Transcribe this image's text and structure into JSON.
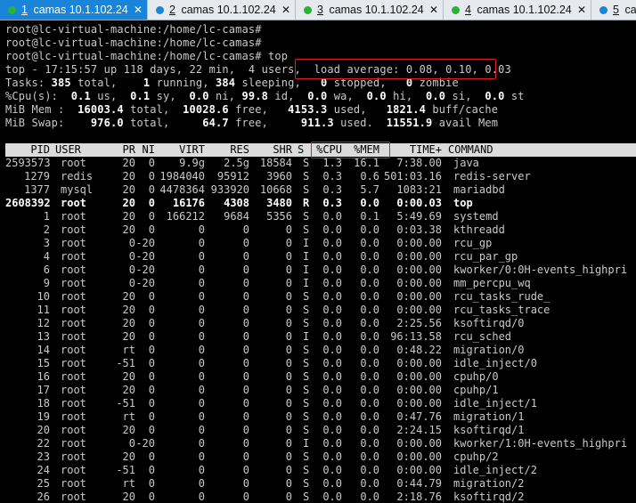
{
  "tabs": [
    {
      "num": "1",
      "label": "camas 10.1.102.24",
      "active": true
    },
    {
      "num": "2",
      "label": "camas 10.1.102.24",
      "active": false
    },
    {
      "num": "3",
      "label": "camas 10.1.102.24",
      "active": false
    },
    {
      "num": "4",
      "label": "camas 10.1.102.24",
      "active": false
    },
    {
      "num": "5",
      "label": "ca",
      "active": false
    }
  ],
  "prompts": [
    "root@lc-virtual-machine:/home/lc-camas#",
    "root@lc-virtual-machine:/home/lc-camas#",
    "root@lc-virtual-machine:/home/lc-camas# top"
  ],
  "summary": {
    "top_line_a": "top - 17:15:57 up 118 days, 22 min,  4 users,  ",
    "load_average": "load average: 0.08, 0.10, 0.03",
    "tasks_label": "Tasks: ",
    "tasks_total": "385",
    "tasks_t1": " total,    ",
    "tasks_running": "1",
    "tasks_t2": " running, ",
    "tasks_sleeping": "384",
    "tasks_t3": " sleeping,   ",
    "tasks_stopped": "0",
    "tasks_t4": " stopped,   ",
    "tasks_zombie": "0",
    "tasks_t5": " zombie",
    "cpu_label": "%Cpu(s):  ",
    "cpu_us": "0.1",
    "cpu_t1": " us,  ",
    "cpu_sy": "0.1",
    "cpu_t2": " sy,  ",
    "cpu_ni": "0.0",
    "cpu_t3": " ni, ",
    "cpu_id": "99.8",
    "cpu_t4": " id,  ",
    "cpu_wa": "0.0",
    "cpu_t5": " wa,  ",
    "cpu_hi": "0.0",
    "cpu_t6": " hi,  ",
    "cpu_si": "0.0",
    "cpu_t7": " si,  ",
    "cpu_st": "0.0",
    "cpu_t8": " st",
    "mem_label": "MiB Mem :  ",
    "mem_total": "16003.4",
    "mem_t1": " total,  ",
    "mem_free": "10028.6",
    "mem_t2": " free,   ",
    "mem_used": "4153.3",
    "mem_t3": " used,   ",
    "mem_buff": "1821.4",
    "mem_t4": " buff/cache",
    "swap_label": "MiB Swap:    ",
    "swap_total": "976.0",
    "swap_t1": " total,     ",
    "swap_free": "64.7",
    "swap_t2": " free,     ",
    "swap_used": "911.3",
    "swap_t3": " used.  ",
    "swap_avail": "11551.9",
    "swap_t4": " avail Mem"
  },
  "columns": [
    "PID",
    "USER",
    "PR",
    "NI",
    "VIRT",
    "RES",
    "SHR",
    "S",
    "%CPU",
    "%MEM",
    "TIME+",
    "COMMAND"
  ],
  "processes": [
    {
      "pid": "2593573",
      "user": "root",
      "pr": "20",
      "ni": "0",
      "virt": "9.9g",
      "res": "2.5g",
      "shr": "18584",
      "s": "S",
      "cpu": "1.3",
      "mem": "16.1",
      "time": "7:38.00",
      "cmd": "java",
      "bold": false
    },
    {
      "pid": "1279",
      "user": "redis",
      "pr": "20",
      "ni": "0",
      "virt": "1984040",
      "res": "95912",
      "shr": "3960",
      "s": "S",
      "cpu": "0.3",
      "mem": "0.6",
      "time": "501:03.16",
      "cmd": "redis-server",
      "bold": false
    },
    {
      "pid": "1377",
      "user": "mysql",
      "pr": "20",
      "ni": "0",
      "virt": "4478364",
      "res": "933920",
      "shr": "10668",
      "s": "S",
      "cpu": "0.3",
      "mem": "5.7",
      "time": "1083:21",
      "cmd": "mariadbd",
      "bold": false
    },
    {
      "pid": "2608392",
      "user": "root",
      "pr": "20",
      "ni": "0",
      "virt": "16176",
      "res": "4308",
      "shr": "3480",
      "s": "R",
      "cpu": "0.3",
      "mem": "0.0",
      "time": "0:00.03",
      "cmd": "top",
      "bold": true
    },
    {
      "pid": "1",
      "user": "root",
      "pr": "20",
      "ni": "0",
      "virt": "166212",
      "res": "9684",
      "shr": "5356",
      "s": "S",
      "cpu": "0.0",
      "mem": "0.1",
      "time": "5:49.69",
      "cmd": "systemd",
      "bold": false
    },
    {
      "pid": "2",
      "user": "root",
      "pr": "20",
      "ni": "0",
      "virt": "0",
      "res": "0",
      "shr": "0",
      "s": "S",
      "cpu": "0.0",
      "mem": "0.0",
      "time": "0:03.38",
      "cmd": "kthreadd",
      "bold": false
    },
    {
      "pid": "3",
      "user": "root",
      "pr": "0",
      "ni": "-20",
      "virt": "0",
      "res": "0",
      "shr": "0",
      "s": "I",
      "cpu": "0.0",
      "mem": "0.0",
      "time": "0:00.00",
      "cmd": "rcu_gp",
      "bold": false
    },
    {
      "pid": "4",
      "user": "root",
      "pr": "0",
      "ni": "-20",
      "virt": "0",
      "res": "0",
      "shr": "0",
      "s": "I",
      "cpu": "0.0",
      "mem": "0.0",
      "time": "0:00.00",
      "cmd": "rcu_par_gp",
      "bold": false
    },
    {
      "pid": "6",
      "user": "root",
      "pr": "0",
      "ni": "-20",
      "virt": "0",
      "res": "0",
      "shr": "0",
      "s": "I",
      "cpu": "0.0",
      "mem": "0.0",
      "time": "0:00.00",
      "cmd": "kworker/0:0H-events_highpri",
      "bold": false
    },
    {
      "pid": "9",
      "user": "root",
      "pr": "0",
      "ni": "-20",
      "virt": "0",
      "res": "0",
      "shr": "0",
      "s": "I",
      "cpu": "0.0",
      "mem": "0.0",
      "time": "0:00.00",
      "cmd": "mm_percpu_wq",
      "bold": false
    },
    {
      "pid": "10",
      "user": "root",
      "pr": "20",
      "ni": "0",
      "virt": "0",
      "res": "0",
      "shr": "0",
      "s": "S",
      "cpu": "0.0",
      "mem": "0.0",
      "time": "0:00.00",
      "cmd": "rcu_tasks_rude_",
      "bold": false
    },
    {
      "pid": "11",
      "user": "root",
      "pr": "20",
      "ni": "0",
      "virt": "0",
      "res": "0",
      "shr": "0",
      "s": "S",
      "cpu": "0.0",
      "mem": "0.0",
      "time": "0:00.00",
      "cmd": "rcu_tasks_trace",
      "bold": false
    },
    {
      "pid": "12",
      "user": "root",
      "pr": "20",
      "ni": "0",
      "virt": "0",
      "res": "0",
      "shr": "0",
      "s": "S",
      "cpu": "0.0",
      "mem": "0.0",
      "time": "2:25.56",
      "cmd": "ksoftirqd/0",
      "bold": false
    },
    {
      "pid": "13",
      "user": "root",
      "pr": "20",
      "ni": "0",
      "virt": "0",
      "res": "0",
      "shr": "0",
      "s": "I",
      "cpu": "0.0",
      "mem": "0.0",
      "time": "96:13.58",
      "cmd": "rcu_sched",
      "bold": false
    },
    {
      "pid": "14",
      "user": "root",
      "pr": "rt",
      "ni": "0",
      "virt": "0",
      "res": "0",
      "shr": "0",
      "s": "S",
      "cpu": "0.0",
      "mem": "0.0",
      "time": "0:48.22",
      "cmd": "migration/0",
      "bold": false
    },
    {
      "pid": "15",
      "user": "root",
      "pr": "-51",
      "ni": "0",
      "virt": "0",
      "res": "0",
      "shr": "0",
      "s": "S",
      "cpu": "0.0",
      "mem": "0.0",
      "time": "0:00.00",
      "cmd": "idle_inject/0",
      "bold": false
    },
    {
      "pid": "16",
      "user": "root",
      "pr": "20",
      "ni": "0",
      "virt": "0",
      "res": "0",
      "shr": "0",
      "s": "S",
      "cpu": "0.0",
      "mem": "0.0",
      "time": "0:00.00",
      "cmd": "cpuhp/0",
      "bold": false
    },
    {
      "pid": "17",
      "user": "root",
      "pr": "20",
      "ni": "0",
      "virt": "0",
      "res": "0",
      "shr": "0",
      "s": "S",
      "cpu": "0.0",
      "mem": "0.0",
      "time": "0:00.00",
      "cmd": "cpuhp/1",
      "bold": false
    },
    {
      "pid": "18",
      "user": "root",
      "pr": "-51",
      "ni": "0",
      "virt": "0",
      "res": "0",
      "shr": "0",
      "s": "S",
      "cpu": "0.0",
      "mem": "0.0",
      "time": "0:00.00",
      "cmd": "idle_inject/1",
      "bold": false
    },
    {
      "pid": "19",
      "user": "root",
      "pr": "rt",
      "ni": "0",
      "virt": "0",
      "res": "0",
      "shr": "0",
      "s": "S",
      "cpu": "0.0",
      "mem": "0.0",
      "time": "0:47.76",
      "cmd": "migration/1",
      "bold": false
    },
    {
      "pid": "20",
      "user": "root",
      "pr": "20",
      "ni": "0",
      "virt": "0",
      "res": "0",
      "shr": "0",
      "s": "S",
      "cpu": "0.0",
      "mem": "0.0",
      "time": "2:24.15",
      "cmd": "ksoftirqd/1",
      "bold": false
    },
    {
      "pid": "22",
      "user": "root",
      "pr": "0",
      "ni": "-20",
      "virt": "0",
      "res": "0",
      "shr": "0",
      "s": "I",
      "cpu": "0.0",
      "mem": "0.0",
      "time": "0:00.00",
      "cmd": "kworker/1:0H-events_highpri",
      "bold": false
    },
    {
      "pid": "23",
      "user": "root",
      "pr": "20",
      "ni": "0",
      "virt": "0",
      "res": "0",
      "shr": "0",
      "s": "S",
      "cpu": "0.0",
      "mem": "0.0",
      "time": "0:00.00",
      "cmd": "cpuhp/2",
      "bold": false
    },
    {
      "pid": "24",
      "user": "root",
      "pr": "-51",
      "ni": "0",
      "virt": "0",
      "res": "0",
      "shr": "0",
      "s": "S",
      "cpu": "0.0",
      "mem": "0.0",
      "time": "0:00.00",
      "cmd": "idle_inject/2",
      "bold": false
    },
    {
      "pid": "25",
      "user": "root",
      "pr": "rt",
      "ni": "0",
      "virt": "0",
      "res": "0",
      "shr": "0",
      "s": "S",
      "cpu": "0.0",
      "mem": "0.0",
      "time": "0:44.79",
      "cmd": "migration/2",
      "bold": false
    },
    {
      "pid": "26",
      "user": "root",
      "pr": "20",
      "ni": "0",
      "virt": "0",
      "res": "0",
      "shr": "0",
      "s": "S",
      "cpu": "0.0",
      "mem": "0.0",
      "time": "2:18.76",
      "cmd": "ksoftirqd/2",
      "bold": false
    }
  ],
  "colors": {
    "tab_active": "#1a84d8",
    "highlight_box": "#e02020",
    "header_bg": "#dcdcdc"
  }
}
